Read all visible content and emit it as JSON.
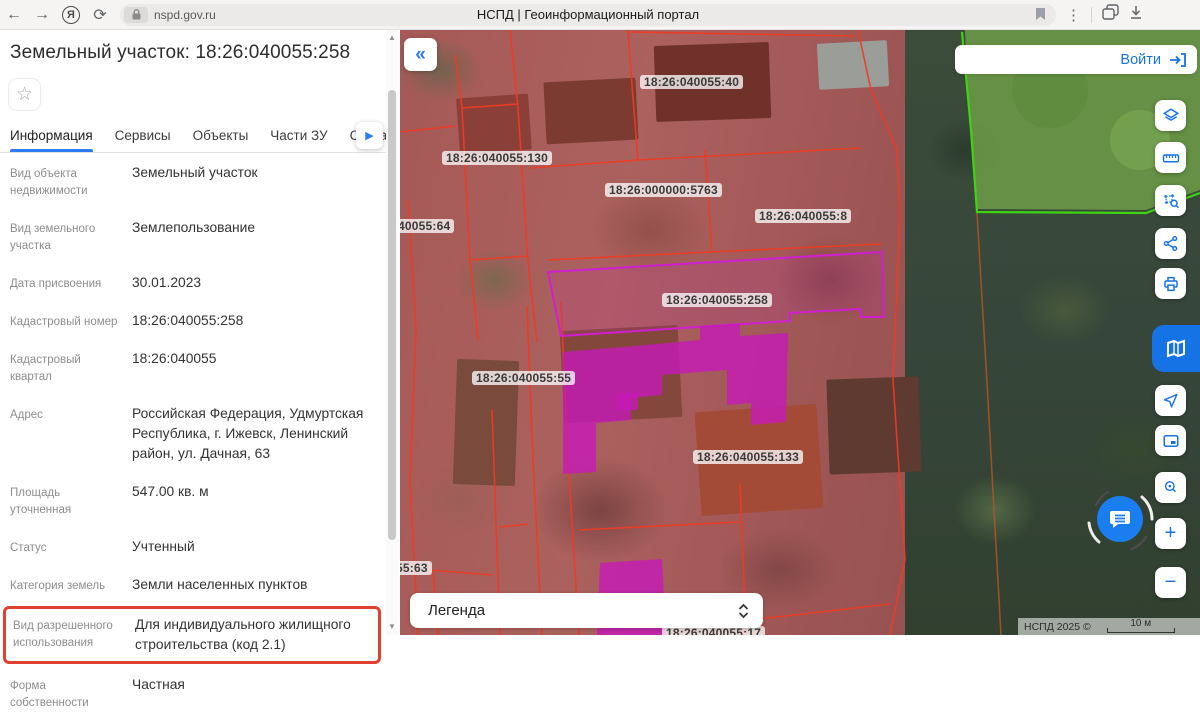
{
  "browser": {
    "url": "nspd.gov.ru",
    "title": "НСПД | Геоинформационный портал"
  },
  "panel": {
    "title": "Земельный участок: 18:26:040055:258",
    "tabs": [
      {
        "label": "Информация",
        "active": true
      },
      {
        "label": "Сервисы",
        "active": false
      },
      {
        "label": "Объекты",
        "active": false
      },
      {
        "label": "Части ЗУ",
        "active": false
      },
      {
        "label": "Состав ЗУ",
        "active": false
      }
    ],
    "fields": [
      {
        "label": "Вид объекта недвижимости",
        "value": "Земельный участок"
      },
      {
        "label": "Вид земельного участка",
        "value": "Землепользование"
      },
      {
        "label": "Дата присвоения",
        "value": "30.01.2023"
      },
      {
        "label": "Кадастровый номер",
        "value": "18:26:040055:258"
      },
      {
        "label": "Кадастровый квартал",
        "value": "18:26:040055"
      },
      {
        "label": "Адрес",
        "value": "Российская Федерация, Удмуртская Республика, г. Ижевск, Ленинский район, ул. Дачная, 63"
      },
      {
        "label": "Площадь уточненная",
        "value": "547.00 кв. м"
      },
      {
        "label": "Статус",
        "value": "Учтенный"
      },
      {
        "label": "Категория земель",
        "value": "Земли населенных пунктов"
      },
      {
        "label": "Вид разрешенного использования",
        "value": "Для индивидуального жилищного строительства (код 2.1)",
        "highlighted": true
      },
      {
        "label": "Форма собственности",
        "value": "Частная"
      }
    ]
  },
  "map": {
    "login_label": "Войти",
    "legend_label": "Легенда",
    "attribution": "НСПД 2025 ©",
    "scale_label": "10 м",
    "labels": [
      "18:26:040055:40",
      "18:26:040055:130",
      "18:26:000000:5763",
      "18:26:040055:8",
      "40055:64",
      "18:26:040055:258",
      "18:26:040055:55",
      "18:26:040055:133",
      "55:63",
      "18:26:040055:17"
    ]
  },
  "colors": {
    "accent_blue": "#1673e6",
    "highlight_red": "#e0402f",
    "parcel_line_red": "#ef3b22",
    "selected_parcel_magenta": "#cf1fd1",
    "boundary_green": "#3ed412"
  }
}
